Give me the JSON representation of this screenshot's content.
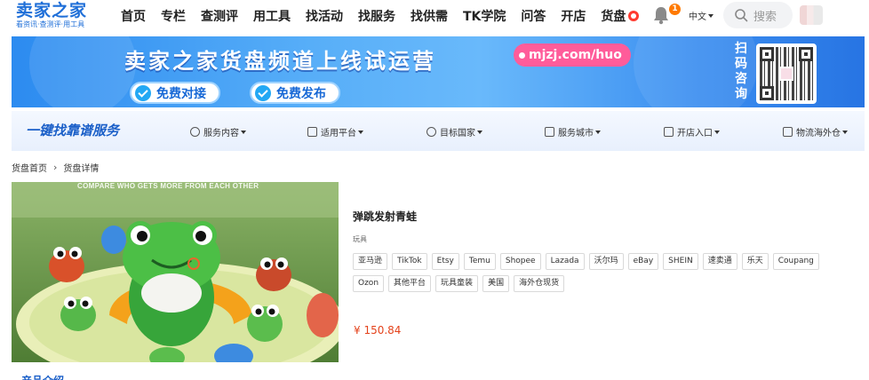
{
  "header": {
    "logo_main": "卖家之家",
    "logo_sub": "看资讯·查测评·用工具",
    "nav": [
      "首页",
      "专栏",
      "查测评",
      "用工具",
      "找活动",
      "找服务",
      "找供需",
      "TK学院",
      "问答",
      "开店",
      "货盘"
    ],
    "notification_count": "1",
    "language": "中文",
    "search_placeholder": "搜索"
  },
  "banner": {
    "title": "卖家之家货盘频道上线试运营",
    "url": "mjzj.com/huo",
    "buttons": [
      "免费对接",
      "免费发布"
    ],
    "qr_label": "扫码咨询"
  },
  "service_bar": {
    "title": "一键找靠谱服务",
    "filters": [
      "服务内容",
      "适用平台",
      "目标国家",
      "服务城市",
      "开店入口",
      "物流海外仓"
    ]
  },
  "breadcrumb": [
    "货盘首页",
    "货盘详情"
  ],
  "product": {
    "image_caption": "COMPARE WHO GETS MORE FROM EACH OTHER",
    "title": "弹跳发射青蛙",
    "category": "玩具",
    "tags": [
      "亚马逊",
      "TikTok",
      "Etsy",
      "Temu",
      "Shopee",
      "Lazada",
      "沃尔玛",
      "eBay",
      "SHEIN",
      "速卖通",
      "乐天",
      "Coupang",
      "Ozon",
      "其他平台",
      "玩具童装",
      "美国",
      "海外仓现货"
    ],
    "price": "¥ 150.84"
  },
  "section": {
    "intro_label": "产品介绍"
  },
  "colors": {
    "brand_blue": "#1f6fd8",
    "price_red": "#e4431c",
    "badge_orange": "#ff7a00",
    "banner_pink": "#ff5c9a"
  }
}
